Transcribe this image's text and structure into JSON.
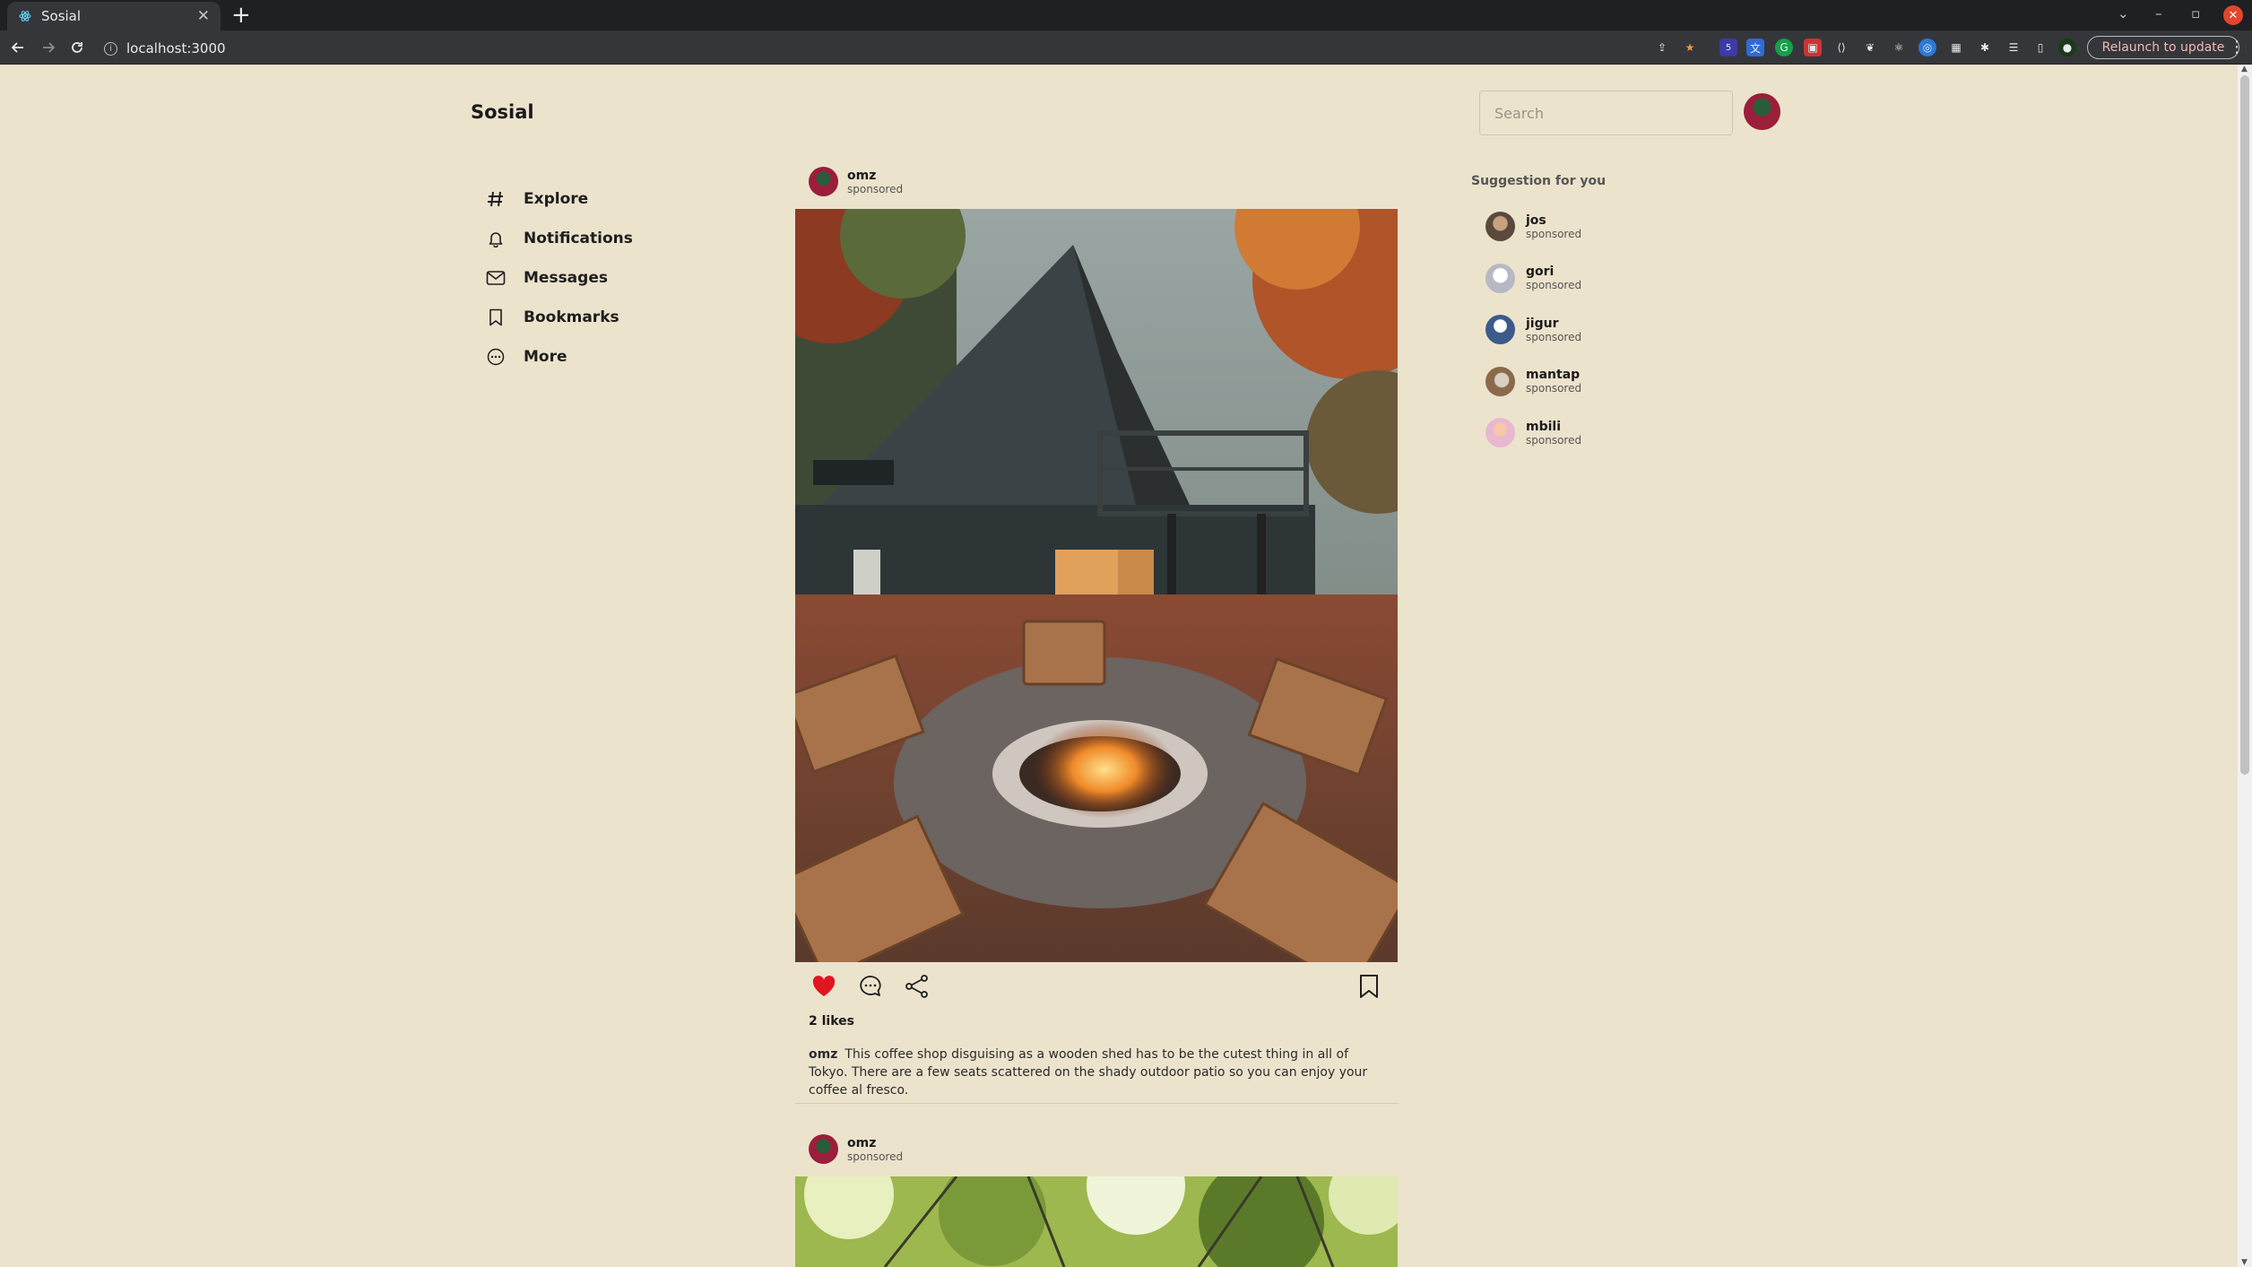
{
  "browser": {
    "tab_title": "Sosial",
    "url": "localhost:3000",
    "relaunch_label": "Relaunch to update",
    "extension_badge": "5"
  },
  "app": {
    "brand": "Sosial",
    "search_placeholder": "Search"
  },
  "nav": {
    "items": [
      {
        "label": "Explore",
        "icon": "hash-icon"
      },
      {
        "label": "Notifications",
        "icon": "bell-icon"
      },
      {
        "label": "Messages",
        "icon": "mail-icon"
      },
      {
        "label": "Bookmarks",
        "icon": "bookmark-icon"
      },
      {
        "label": "More",
        "icon": "more-circle-icon"
      }
    ]
  },
  "posts": [
    {
      "user": "omz",
      "sub": "sponsored",
      "liked": true,
      "likes_text": "2 likes",
      "caption_user": "omz",
      "caption": "This coffee shop disguising as a wooden shed has to be the cutest thing in all of Tokyo. There are a few seats scattered on the shady outdoor patio so you can enjoy your coffee al fresco."
    },
    {
      "user": "omz",
      "sub": "sponsored"
    }
  ],
  "suggestions": {
    "title": "Suggestion for you",
    "items": [
      {
        "name": "jos",
        "sub": "sponsored",
        "color": "#5a4a3c"
      },
      {
        "name": "gori",
        "sub": "sponsored",
        "color": "#d9d9e0"
      },
      {
        "name": "jigur",
        "sub": "sponsored",
        "color": "#3c5a8a"
      },
      {
        "name": "mantap",
        "sub": "sponsored",
        "color": "#8a6a4a"
      },
      {
        "name": "mbili",
        "sub": "sponsored",
        "color": "#e8b8d0"
      }
    ]
  },
  "colors": {
    "background": "#ECE3CC",
    "like": "#e0151f"
  }
}
